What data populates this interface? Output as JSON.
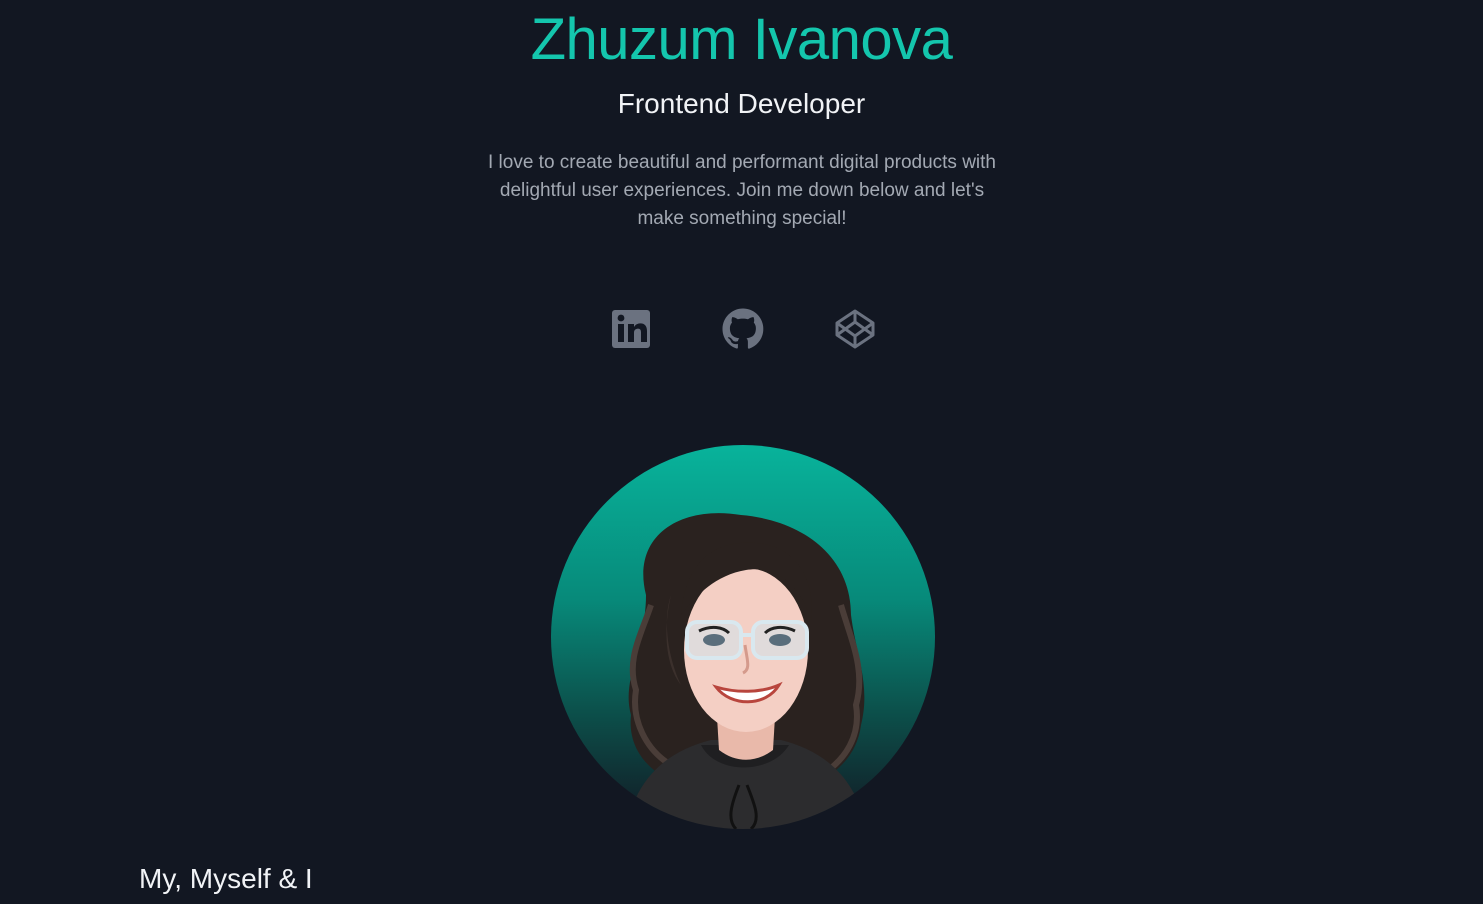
{
  "hero": {
    "name": "Zhuzum Ivanova",
    "role": "Frontend Developer",
    "bio": "I love to create beautiful and performant digital products with delightful user experiences. Join me down below and let's make something special!"
  },
  "socials": [
    {
      "icon": "linkedin-icon"
    },
    {
      "icon": "github-icon"
    },
    {
      "icon": "codepen-icon"
    }
  ],
  "avatar": {
    "icon": "avatar-illustration"
  },
  "about": {
    "title": "My, Myself & I"
  },
  "colors": {
    "background": "#121722",
    "accent": "#14c6ad",
    "icon": "#6b7280",
    "text": "#f1f3f6",
    "muted": "#a3a9b3"
  }
}
